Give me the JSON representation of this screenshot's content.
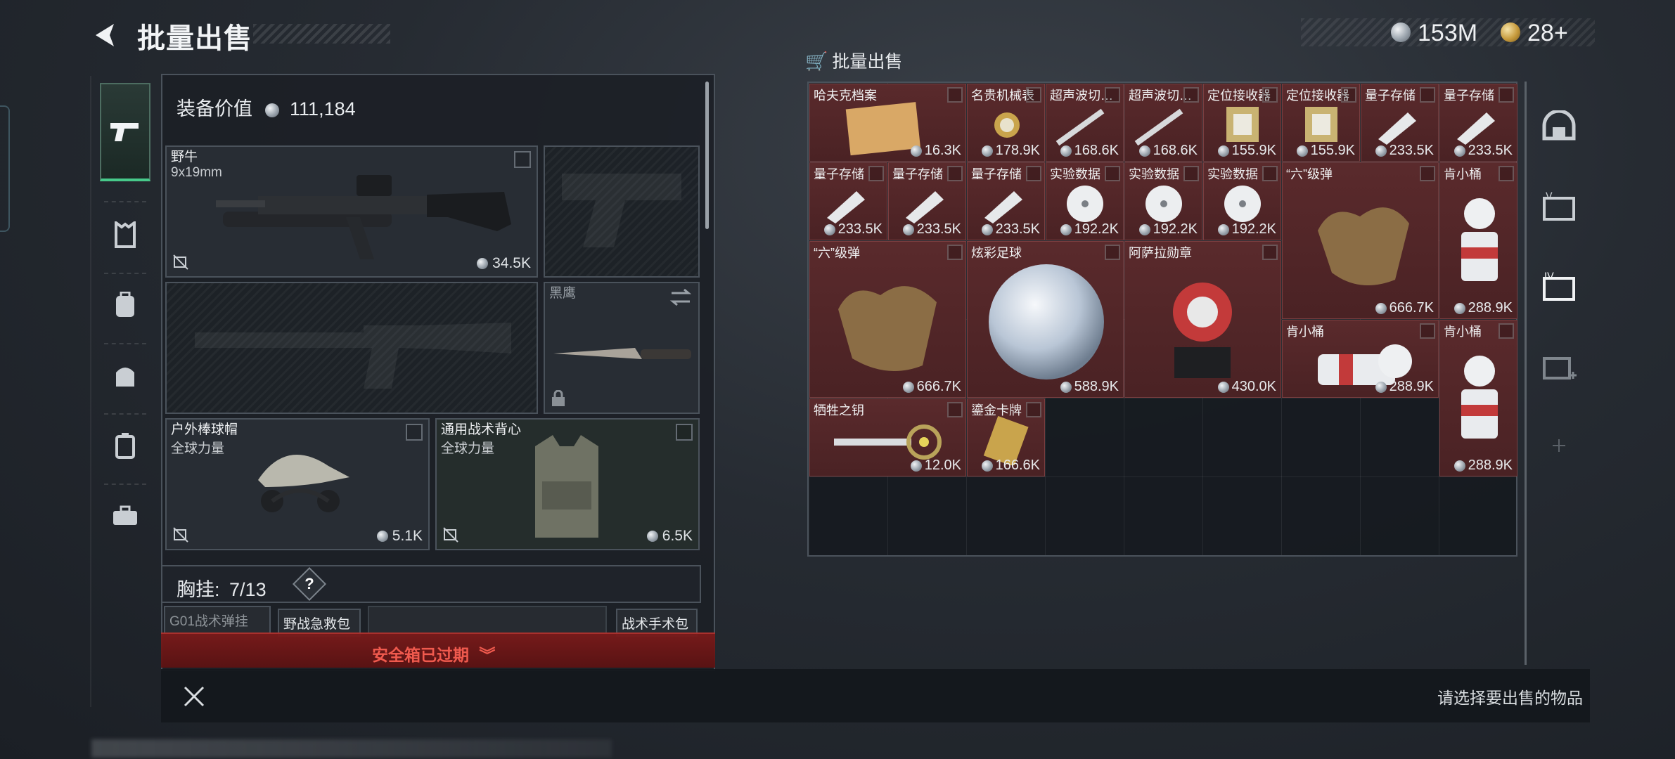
{
  "header": {
    "title": "批量出售",
    "coins": "153M",
    "gold": "28+",
    "panel_title": "批量出售"
  },
  "equipment": {
    "value_label": "装备价值",
    "value": "111,184",
    "primary_weapon": {
      "name": "野牛",
      "ammo": "9x19mm",
      "price": "34.5K"
    },
    "melee": {
      "name": "黑鹰"
    },
    "helmet": {
      "name": "户外棒球帽",
      "sub": "全球力量",
      "price": "5.1K"
    },
    "armor": {
      "name": "通用战术背心",
      "sub": "全球力量",
      "price": "6.5K"
    },
    "chest_rig": {
      "label": "胸挂:",
      "count": "7/13",
      "help": "?"
    },
    "mini_slots": [
      "G01战术弹挂",
      "野战急救包",
      "战术手术包"
    ],
    "expired": "安全箱已过期"
  },
  "grid": {
    "items": [
      {
        "name": "哈夫克档案",
        "price": "16.3K"
      },
      {
        "name": "名贵机械表",
        "price": "178.9K"
      },
      {
        "name": "超声波切…",
        "price": "168.6K"
      },
      {
        "name": "超声波切…",
        "price": "168.6K"
      },
      {
        "name": "定位接收器",
        "price": "155.9K"
      },
      {
        "name": "定位接收器",
        "price": "155.9K"
      },
      {
        "name": "量子存储",
        "price": "233.5K"
      },
      {
        "name": "量子存储",
        "price": "233.5K"
      },
      {
        "name": "量子存储",
        "price": "233.5K"
      },
      {
        "name": "量子存储",
        "price": "233.5K"
      },
      {
        "name": "量子存储",
        "price": "233.5K"
      },
      {
        "name": "实验数据",
        "price": "192.2K"
      },
      {
        "name": "实验数据",
        "price": "192.2K"
      },
      {
        "name": "实验数据",
        "price": "192.2K"
      },
      {
        "name": "“六”级弹",
        "price": "666.7K"
      },
      {
        "name": "肯小桶",
        "price": "288.9K"
      },
      {
        "name": "“六”级弹",
        "price": "666.7K"
      },
      {
        "name": "炫彩足球",
        "price": "588.9K"
      },
      {
        "name": "阿萨拉勋章",
        "price": "430.0K"
      },
      {
        "name": "肯小桶",
        "price": "288.9K"
      },
      {
        "name": "肯小桶",
        "price": "288.9K"
      },
      {
        "name": "牺牲之钥",
        "price": "12.0K"
      },
      {
        "name": "鎏金卡牌",
        "price": "166.6K"
      }
    ]
  },
  "footer": {
    "hint": "请选择要出售的物品"
  },
  "colors": {
    "accent_green": "#47c98a",
    "item_bg": "#4a2224",
    "expired_text": "#f05a4e"
  },
  "icons": [
    "back-arrow-icon",
    "silver-coin-icon",
    "gold-coin-icon",
    "cart-icon",
    "pistol-icon",
    "armor-icon",
    "backpack-icon",
    "bag-icon",
    "case-icon",
    "toolbox-icon",
    "helmet-icon",
    "tag-icon",
    "tag-add-icon",
    "plus-icon",
    "close-icon"
  ]
}
